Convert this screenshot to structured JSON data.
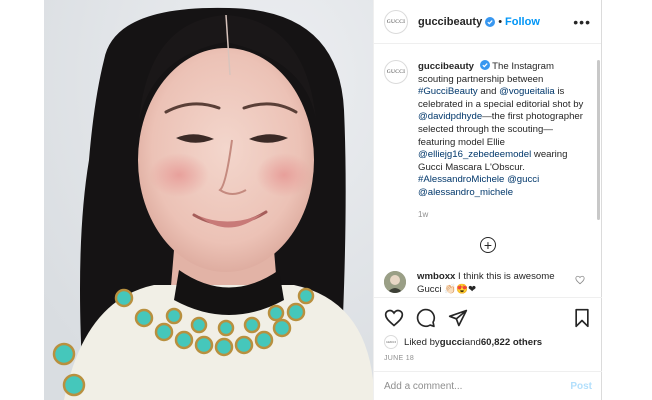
{
  "header": {
    "username": "guccibeauty",
    "follow_label": "Follow",
    "separator": "•",
    "more_icon": "ellipsis-icon",
    "avatar_text": "GUCCI"
  },
  "caption": {
    "username": "guccibeauty",
    "t1": " The Instagram scouting partnership between ",
    "tag1": "#GucciBeauty",
    "t2": " and ",
    "mention1": "@vogueitalia",
    "t3": " is celebrated in a special editorial shot by ",
    "mention2": "@davidpdhyde",
    "t4": "—the first photographer selected through the scouting—featuring model Ellie ",
    "mention3": "@elliejg16_zebedeemodel",
    "t5": " wearing Gucci Mascara L'Obscur. ",
    "tag2": "#AlessandroMichele",
    "t6": " ",
    "mention4": "@gucci",
    "t7": " ",
    "mention5": "@alessandro_michele",
    "time_ago": "1w"
  },
  "comment": {
    "username": "wmboxx",
    "text": " I think this is awesome Gucci ",
    "emoji": "👏🏻😍❤"
  },
  "likes": {
    "prefix": "Liked by ",
    "user": "gucci",
    "middle": " and ",
    "count": "60,822 others"
  },
  "date": "JUNE 18",
  "add_comment": {
    "placeholder": "Add a comment...",
    "post_label": "Post"
  },
  "colors": {
    "accent": "#0095f6",
    "link": "#00376b",
    "verified": "#3897f0",
    "post_disabled": "#b2dffc"
  }
}
